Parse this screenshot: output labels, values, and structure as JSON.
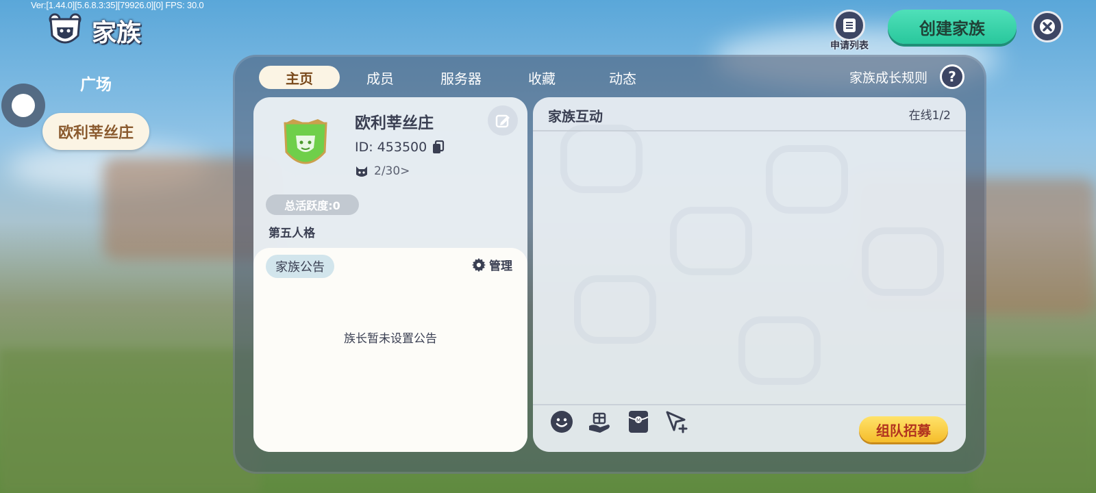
{
  "debug": {
    "text": "Ver:[1.44.0][5.6.8.3:35][79926.0][0] FPS: 30.0"
  },
  "header": {
    "title": "家族",
    "title_icon": "shield-bear-icon"
  },
  "sidebar": {
    "items": [
      {
        "label": "广场",
        "selected": false
      },
      {
        "label": "欧利莘丝庄",
        "selected": true
      }
    ]
  },
  "top_right": {
    "apply_list_label": "申请列表",
    "create_family_label": "创建家族",
    "close_icon": "close-icon"
  },
  "tabs": [
    {
      "label": "主页",
      "active": true
    },
    {
      "label": "成员",
      "active": false
    },
    {
      "label": "服务器",
      "active": false
    },
    {
      "label": "收藏",
      "active": false
    },
    {
      "label": "动态",
      "active": false
    }
  ],
  "rules": {
    "label": "家族成长规则",
    "help_icon": "help-icon"
  },
  "family": {
    "name": "欧利莘丝庄",
    "id_text": "ID: 453500",
    "members_text": "2/30>",
    "activity_text": "总活跃度:0",
    "tagline": "第五人格"
  },
  "notice": {
    "tag": "家族公告",
    "manage_label": "管理",
    "empty_text": "族长暂未设置公告"
  },
  "chat": {
    "title": "家族互动",
    "online_text": "在线1/2",
    "tools": [
      "emoji-icon",
      "gift-icon",
      "red-packet-icon",
      "send-location-icon"
    ],
    "recruit_label": "组队招募"
  },
  "colors": {
    "accent_green": "#2fd1a5",
    "accent_yellow": "#f7c232",
    "tab_active_bg": "#fbf4e4",
    "panel_bg": "#48566f"
  }
}
